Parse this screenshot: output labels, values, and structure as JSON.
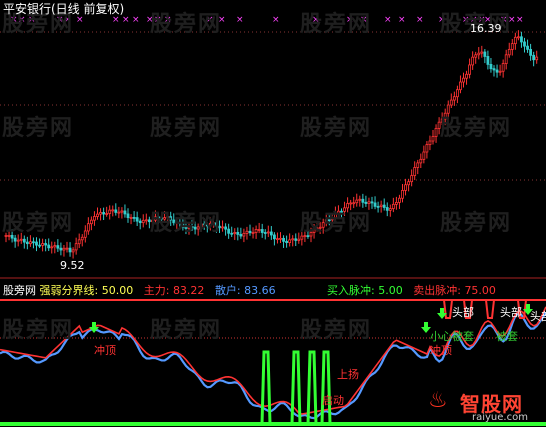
{
  "window": {
    "title": "平安银行(日线 前复权)"
  },
  "watermark": "股旁网",
  "upper_panel": {
    "price_high_label": "16.39",
    "price_low_label": "9.52",
    "colors": {
      "up": "#ff3333",
      "down": "#33cccc",
      "marks": "#ff44ff",
      "grid": "#883333"
    }
  },
  "indicator_header": {
    "site": "股旁网",
    "items": [
      {
        "key": "强弱分界线:",
        "value": "50.00",
        "color": "#ffff55"
      },
      {
        "key": "主力:",
        "value": "83.22",
        "color": "#ff3333"
      },
      {
        "key": "散户:",
        "value": "83.66",
        "color": "#5599ff"
      },
      {
        "key": "买入脉冲:",
        "value": "5.00",
        "color": "#33ff33"
      },
      {
        "key": "卖出脉冲:",
        "value": "75.00",
        "color": "#ff3333"
      }
    ]
  },
  "annotations": {
    "chongding_1": "冲顶",
    "chongding_2": "冲顶",
    "shangyang": "上扬",
    "qidong": "启动",
    "toubu_1": "头部",
    "toubu_2": "头部",
    "toubu_3": "头部",
    "xiaoxin": "小心被套",
    "beitao": "被套"
  },
  "footer": {
    "logo": "智股网",
    "url": "raiyue.com"
  },
  "chart_data": {
    "type": "candlestick",
    "price_range": [
      9.52,
      16.39
    ],
    "indicator_range": [
      0,
      100
    ],
    "indicator_series": [
      {
        "name": "主力",
        "color": "#ff3333"
      },
      {
        "name": "散户",
        "color": "#5599ff"
      }
    ],
    "thresholds": {
      "强弱分界线": 50.0,
      "买入脉冲": 5.0,
      "卖出脉冲": 75.0
    }
  }
}
